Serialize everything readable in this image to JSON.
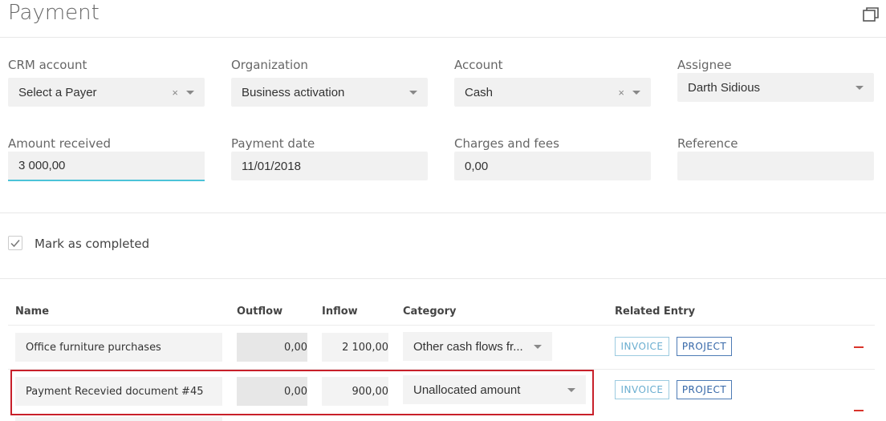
{
  "page": {
    "title": "Payment"
  },
  "form": {
    "crm_account": {
      "label": "CRM account",
      "value": "Select a Payer",
      "clear": "×"
    },
    "organization": {
      "label": "Organization",
      "value": "Business activation"
    },
    "account": {
      "label": "Account",
      "value": "Cash",
      "clear": "×"
    },
    "assignee": {
      "label": "Assignee",
      "value": "Darth Sidious"
    },
    "amount_received": {
      "label": "Amount received",
      "value": "3 000,00"
    },
    "payment_date": {
      "label": "Payment date",
      "value": "11/01/2018"
    },
    "charges_and_fees": {
      "label": "Charges and fees",
      "value": "0,00"
    },
    "reference": {
      "label": "Reference",
      "value": ""
    }
  },
  "mark_completed": {
    "label": "Mark as completed",
    "checked": true
  },
  "table": {
    "headers": {
      "name": "Name",
      "outflow": "Outflow",
      "inflow": "Inflow",
      "category": "Category",
      "related": "Related Entry"
    },
    "rows": [
      {
        "name": "Office furniture purchases",
        "outflow": "0,00",
        "inflow": "2 100,00",
        "category": "Other cash flows fr...",
        "invoice": "INVOICE",
        "project": "PROJECT"
      },
      {
        "name": "Payment Recevied document #45",
        "outflow": "0,00",
        "inflow": "900,00",
        "category": "Unallocated amount",
        "invoice": "INVOICE",
        "project": "PROJECT"
      }
    ]
  },
  "colors": {
    "accent": "#4cc3d8",
    "remove": "#d9342b",
    "highlight": "#c8202a",
    "project": "#3567a8",
    "invoice": "#6aaed0"
  }
}
